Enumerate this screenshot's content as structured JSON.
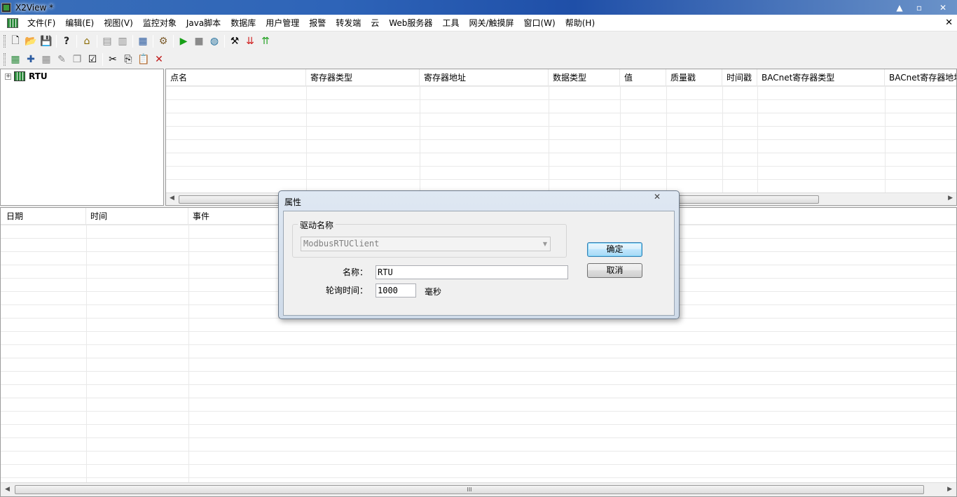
{
  "window": {
    "title": "X2View *",
    "controls": [
      "▲",
      "▫",
      "✕"
    ]
  },
  "menu": {
    "items": [
      "文件(F)",
      "编辑(E)",
      "视图(V)",
      "监控对象",
      "Java脚本",
      "数据库",
      "用户管理",
      "报警",
      "转发端",
      "云",
      "Web服务器",
      "工具",
      "网关/触摸屏",
      "窗口(W)",
      "帮助(H)"
    ],
    "mdi_close": "✕"
  },
  "toolbar1": {
    "icons": [
      "new-file-icon",
      "open-folder-icon",
      "save-icon",
      "help-icon",
      "home-icon",
      "screen-icon",
      "print-icon",
      "device-icon",
      "config-icon",
      "play-icon",
      "stop-icon",
      "refresh-icon",
      "tools-icon",
      "load-icon",
      "up-icon"
    ]
  },
  "toolbar2": {
    "icons": [
      "add-driver-icon",
      "add-point-icon",
      "grid-icon",
      "wrench-icon",
      "copy-page-icon",
      "properties-icon",
      "cut-icon",
      "copy-icon",
      "paste-icon",
      "delete-icon"
    ]
  },
  "tree": {
    "root": {
      "expander": "+",
      "label": "RTU"
    }
  },
  "points_grid": {
    "columns": [
      "点名",
      "寄存器类型",
      "寄存器地址",
      "数据类型",
      "值",
      "质量戳",
      "时间戳",
      "BACnet寄存器类型",
      "BACnet寄存器地址"
    ]
  },
  "events_grid": {
    "columns": [
      "日期",
      "时间",
      "事件"
    ]
  },
  "scroll": {
    "left": "◀",
    "right": "▶",
    "grip": "III"
  },
  "dialog": {
    "title": "属性",
    "close": "✕",
    "group_label": "驱动名称",
    "driver_value": "ModbusRTUClient",
    "combo_arrow": "▼",
    "name_label": "名称：",
    "name_value": "RTU",
    "poll_label": "轮询时间：",
    "poll_value": "1000",
    "poll_unit": "毫秒",
    "ok_label": "确定",
    "cancel_label": "取消"
  }
}
